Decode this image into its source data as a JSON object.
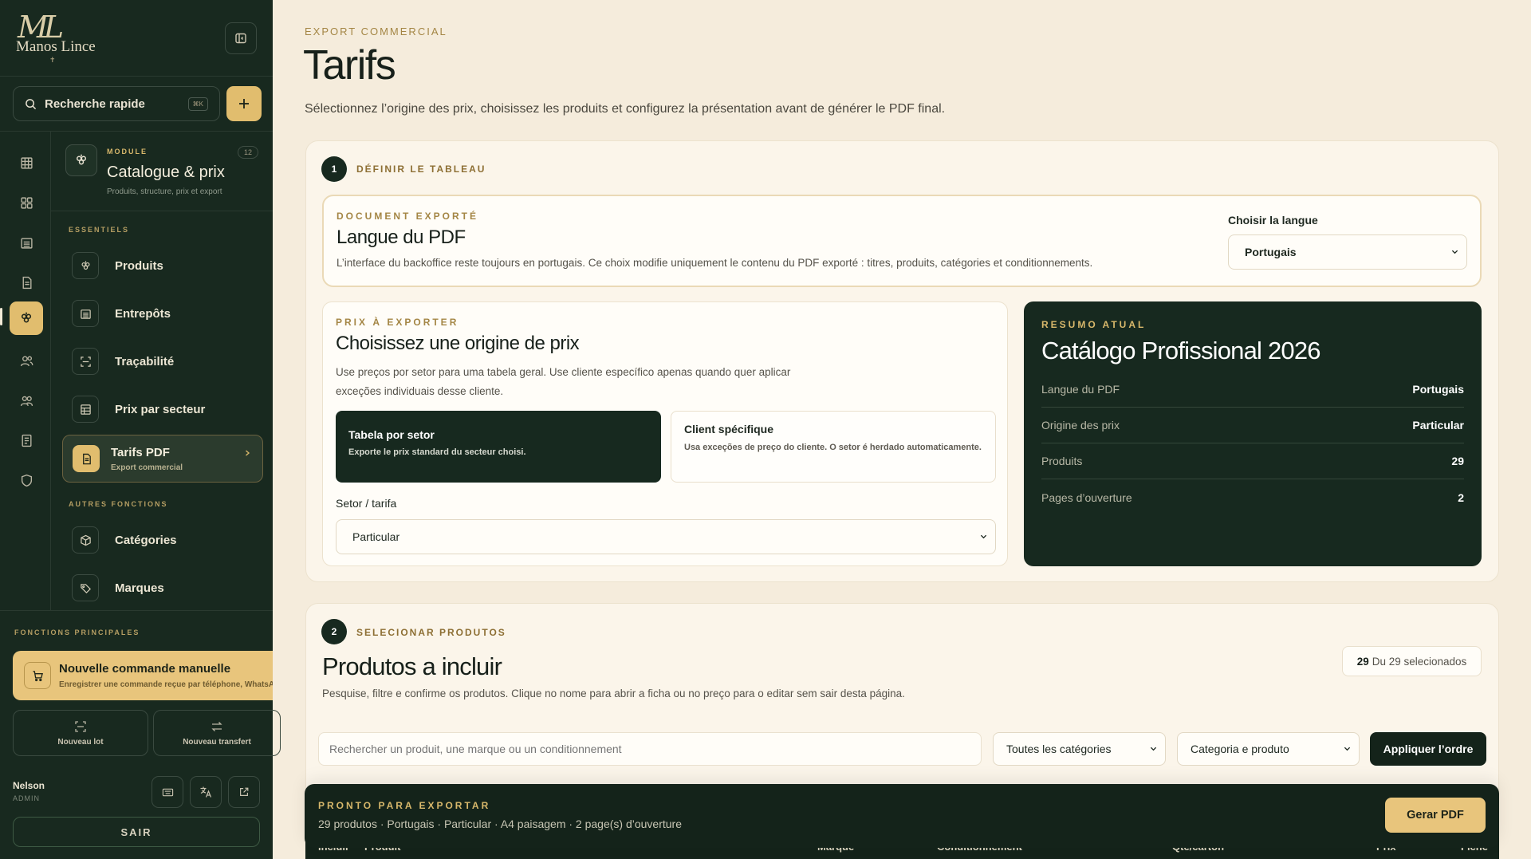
{
  "brand": {
    "monogram": "ML",
    "name": "Manos Lince",
    "mark": "✝"
  },
  "search": {
    "label": "Recherche rapide",
    "shortcut": "⌘K"
  },
  "module": {
    "kicker": "MODULE",
    "count": "12",
    "title": "Catalogue & prix",
    "subtitle": "Produits, structure, prix et export"
  },
  "nav": {
    "essentials_label": "ESSENTIELS",
    "others_label": "AUTRES FONCTIONS",
    "items": [
      {
        "label": "Produits",
        "icon": "grape-icon"
      },
      {
        "label": "Entrepôts",
        "icon": "warehouse-icon"
      },
      {
        "label": "Traçabilité",
        "icon": "scan-icon"
      },
      {
        "label": "Prix par secteur",
        "icon": "table-icon"
      }
    ],
    "active": {
      "label": "Tarifs PDF",
      "sub": "Export commercial",
      "icon": "document-icon"
    },
    "others": [
      {
        "label": "Catégories",
        "icon": "box-icon"
      },
      {
        "label": "Marques",
        "icon": "tag-icon"
      }
    ]
  },
  "main_functions": {
    "label": "FONCTIONS PRINCIPALES",
    "cta_title": "Nouvelle commande manuelle",
    "cta_sub": "Enregistrer une commande reçue par téléphone, WhatsApp",
    "lot_label": "Nouveau lot",
    "transfer_label": "Nouveau transfert"
  },
  "user": {
    "name": "Nelson",
    "role": "ADMIN",
    "logout": "SAIR"
  },
  "page": {
    "kicker": "EXPORT COMMERCIAL",
    "title": "Tarifs",
    "description": "Sélectionnez l’origine des prix, choisissez les produits et configurez la présentation avant de générer le PDF final."
  },
  "step1": {
    "number": "1",
    "label": "DÉFINIR LE TABLEAU",
    "lang": {
      "kicker": "DOCUMENT EXPORTÉ",
      "title": "Langue du PDF",
      "description": "L’interface du backoffice reste toujours en portugais. Ce choix modifie uniquement le contenu du PDF exporté : titres, produits, catégories et conditionnements.",
      "select_label": "Choisir la langue",
      "select_value": "Portugais"
    },
    "price": {
      "kicker": "PRIX À EXPORTER",
      "title": "Choisissez une origine de prix",
      "description": "Use preços por setor para uma tabela geral. Use cliente específico apenas quando quer aplicar exceções individuais desse cliente.",
      "option_selected_title": "Tabela por setor",
      "option_selected_sub": "Exporte le prix standard du secteur choisi.",
      "option_other_title": "Client spécifique",
      "option_other_sub": "Usa exceções de preço do cliente. O setor é herdado automaticamente.",
      "setor_label": "Setor / tarifa",
      "setor_value": "Particular"
    },
    "summary": {
      "kicker": "RESUMO ATUAL",
      "title": "Catálogo Profissional 2026",
      "rows": [
        {
          "key": "Langue du PDF",
          "value": "Portugais"
        },
        {
          "key": "Origine des prix",
          "value": "Particular"
        },
        {
          "key": "Produits",
          "value": "29"
        },
        {
          "key": "Pages d’ouverture",
          "value": "2"
        }
      ]
    }
  },
  "step2": {
    "number": "2",
    "label": "SELECIONAR PRODUTOS",
    "title": "Produtos a incluir",
    "description": "Pesquise, filtre e confirme os produtos. Clique no nome para abrir a ficha ou no preço para o editar sem sair desta página.",
    "selected_count": "29",
    "selected_suffix": "Du 29 selecionados",
    "search_placeholder": "Rechercher un produit, une marque ou un conditionnement",
    "category_value": "Toutes les catégories",
    "order_value": "Categoria e produto",
    "apply_label": "Appliquer l’ordre",
    "columns": [
      "Incluir",
      "Produit",
      "Marque",
      "Conditionnement",
      "Qté/carton",
      "Prix",
      "Fiche"
    ]
  },
  "export_bar": {
    "kicker": "PRONTO PARA EXPORTAR",
    "summary": "29 produtos · Portugais · Particular · A4 paisagem · 2 page(s) d’ouverture",
    "button": "Gerar PDF"
  },
  "colors": {
    "sidebar": "#18291f",
    "accent": "#e1bd6e",
    "background": "#f5ecdc",
    "dark": "#17291f"
  }
}
